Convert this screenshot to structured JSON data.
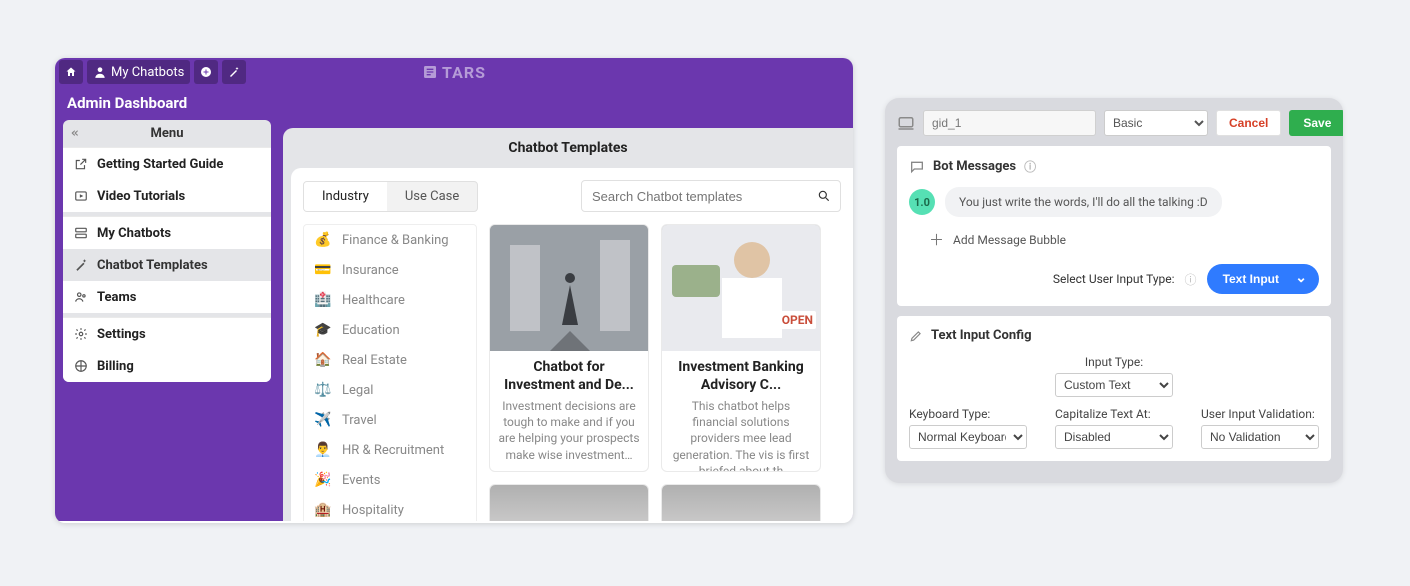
{
  "tars": {
    "brand": "TARS",
    "header": {
      "my_chatbots": "My Chatbots"
    },
    "page_title": "Admin Dashboard",
    "menu": {
      "title": "Menu",
      "items": [
        {
          "label": "Getting Started Guide"
        },
        {
          "label": "Video Tutorials"
        },
        {
          "label": "My Chatbots"
        },
        {
          "label": "Chatbot Templates"
        },
        {
          "label": "Teams"
        },
        {
          "label": "Settings"
        },
        {
          "label": "Billing"
        }
      ]
    },
    "main": {
      "title": "Chatbot Templates",
      "tabs": {
        "industry": "Industry",
        "use_case": "Use Case"
      },
      "search_placeholder": "Search Chatbot templates",
      "categories": [
        {
          "emoji": "💰",
          "label": "Finance & Banking"
        },
        {
          "emoji": "💳",
          "label": "Insurance"
        },
        {
          "emoji": "🏥",
          "label": "Healthcare"
        },
        {
          "emoji": "🎓",
          "label": "Education"
        },
        {
          "emoji": "🏠",
          "label": "Real Estate"
        },
        {
          "emoji": "⚖️",
          "label": "Legal"
        },
        {
          "emoji": "✈️",
          "label": "Travel"
        },
        {
          "emoji": "👨‍💼",
          "label": "HR & Recruitment"
        },
        {
          "emoji": "🎉",
          "label": "Events"
        },
        {
          "emoji": "🏨",
          "label": "Hospitality"
        }
      ],
      "cards": [
        {
          "title": "Chatbot for Investment and De...",
          "desc": "Investment decisions are tough to make and if you are helping your prospects make wise investment…"
        },
        {
          "title": "Investment Banking Advisory C...",
          "desc": "This chatbot helps financial solutions providers mee lead generation. The vis is first briefed about th"
        }
      ]
    }
  },
  "config": {
    "name": "gid_1",
    "type": "Basic",
    "cancel": "Cancel",
    "save": "Save",
    "bot_messages": {
      "title": "Bot Messages",
      "badge": "1.0",
      "bubble": "You just write the words, I'll do all the talking :D",
      "add": "Add Message Bubble",
      "select_uit": "Select User Input Type:",
      "text_input": "Text Input"
    },
    "text_input_config": {
      "title": "Text Input Config",
      "input_type_label": "Input Type:",
      "input_type": "Custom Text",
      "keyboard_label": "Keyboard Type:",
      "keyboard": "Normal Keyboard",
      "cap_label": "Capitalize Text At:",
      "cap": "Disabled",
      "validation_label": "User Input Validation:",
      "validation": "No Validation"
    }
  }
}
